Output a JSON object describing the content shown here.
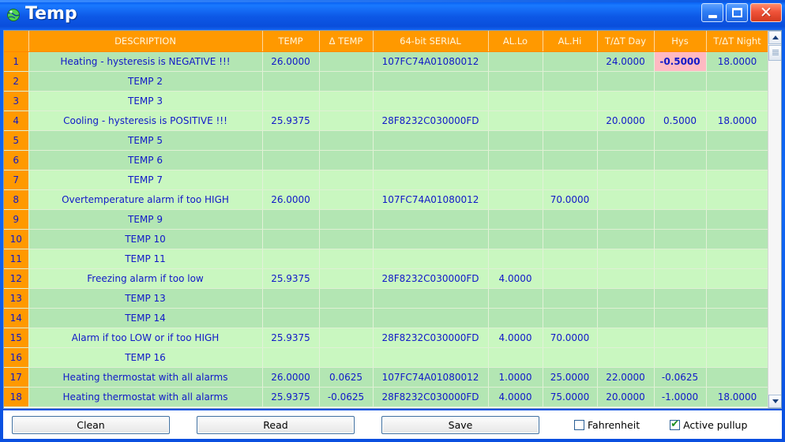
{
  "window": {
    "title": "Temp",
    "icon": "globe-icon",
    "minimize_label": "–",
    "maximize_label": "☐",
    "close_label": "✕",
    "accent_titlebar": "#0d58e6",
    "accent_header": "#ff9900",
    "row_dark": "#b3e6b3",
    "row_light": "#c9f7c0",
    "highlight_bg": "#ffb9c2",
    "text_color": "#1018c8"
  },
  "grid": {
    "columns": [
      {
        "key": "num",
        "label": ""
      },
      {
        "key": "desc",
        "label": "DESCRIPTION"
      },
      {
        "key": "temp",
        "label": "TEMP"
      },
      {
        "key": "dtemp",
        "label": "Δ TEMP"
      },
      {
        "key": "ser",
        "label": "64-bit SERIAL"
      },
      {
        "key": "allo",
        "label": "AL.Lo"
      },
      {
        "key": "alhi",
        "label": "AL.Hi"
      },
      {
        "key": "day",
        "label": "T/ΔT Day"
      },
      {
        "key": "hys",
        "label": "Hys"
      },
      {
        "key": "night",
        "label": "T/ΔT Night"
      }
    ],
    "rows": [
      {
        "num": "1",
        "desc": "Heating - hysteresis is NEGATIVE !!!",
        "temp": "26.0000",
        "dtemp": "",
        "ser": "107FC74A01080012",
        "allo": "",
        "alhi": "",
        "day": "24.0000",
        "hys": "-0.5000",
        "night": "18.0000",
        "shade": "dark",
        "hys_highlight": true
      },
      {
        "num": "2",
        "desc": "TEMP 2",
        "temp": "",
        "dtemp": "",
        "ser": "",
        "allo": "",
        "alhi": "",
        "day": "",
        "hys": "",
        "night": "",
        "shade": "dark",
        "hys_highlight": false
      },
      {
        "num": "3",
        "desc": "TEMP 3",
        "temp": "",
        "dtemp": "",
        "ser": "",
        "allo": "",
        "alhi": "",
        "day": "",
        "hys": "",
        "night": "",
        "shade": "light",
        "hys_highlight": false
      },
      {
        "num": "4",
        "desc": "Cooling - hysteresis is POSITIVE !!!",
        "temp": "25.9375",
        "dtemp": "",
        "ser": "28F8232C030000FD",
        "allo": "",
        "alhi": "",
        "day": "20.0000",
        "hys": "0.5000",
        "night": "18.0000",
        "shade": "light",
        "hys_highlight": false
      },
      {
        "num": "5",
        "desc": "TEMP 5",
        "temp": "",
        "dtemp": "",
        "ser": "",
        "allo": "",
        "alhi": "",
        "day": "",
        "hys": "",
        "night": "",
        "shade": "dark",
        "hys_highlight": false
      },
      {
        "num": "6",
        "desc": "TEMP 6",
        "temp": "",
        "dtemp": "",
        "ser": "",
        "allo": "",
        "alhi": "",
        "day": "",
        "hys": "",
        "night": "",
        "shade": "dark",
        "hys_highlight": false
      },
      {
        "num": "7",
        "desc": "TEMP 7",
        "temp": "",
        "dtemp": "",
        "ser": "",
        "allo": "",
        "alhi": "",
        "day": "",
        "hys": "",
        "night": "",
        "shade": "light",
        "hys_highlight": false
      },
      {
        "num": "8",
        "desc": "Overtemperature alarm if too HIGH",
        "temp": "26.0000",
        "dtemp": "",
        "ser": "107FC74A01080012",
        "allo": "",
        "alhi": "70.0000",
        "day": "",
        "hys": "",
        "night": "",
        "shade": "light",
        "hys_highlight": false
      },
      {
        "num": "9",
        "desc": "TEMP 9",
        "temp": "",
        "dtemp": "",
        "ser": "",
        "allo": "",
        "alhi": "",
        "day": "",
        "hys": "",
        "night": "",
        "shade": "dark",
        "hys_highlight": false
      },
      {
        "num": "10",
        "desc": "TEMP 10",
        "temp": "",
        "dtemp": "",
        "ser": "",
        "allo": "",
        "alhi": "",
        "day": "",
        "hys": "",
        "night": "",
        "shade": "dark",
        "hys_highlight": false
      },
      {
        "num": "11",
        "desc": "TEMP 11",
        "temp": "",
        "dtemp": "",
        "ser": "",
        "allo": "",
        "alhi": "",
        "day": "",
        "hys": "",
        "night": "",
        "shade": "light",
        "hys_highlight": false
      },
      {
        "num": "12",
        "desc": "Freezing alarm if too low",
        "temp": "25.9375",
        "dtemp": "",
        "ser": "28F8232C030000FD",
        "allo": "4.0000",
        "alhi": "",
        "day": "",
        "hys": "",
        "night": "",
        "shade": "light",
        "hys_highlight": false
      },
      {
        "num": "13",
        "desc": "TEMP 13",
        "temp": "",
        "dtemp": "",
        "ser": "",
        "allo": "",
        "alhi": "",
        "day": "",
        "hys": "",
        "night": "",
        "shade": "dark",
        "hys_highlight": false
      },
      {
        "num": "14",
        "desc": "TEMP 14",
        "temp": "",
        "dtemp": "",
        "ser": "",
        "allo": "",
        "alhi": "",
        "day": "",
        "hys": "",
        "night": "",
        "shade": "dark",
        "hys_highlight": false
      },
      {
        "num": "15",
        "desc": "Alarm if too LOW or if too HIGH",
        "temp": "25.9375",
        "dtemp": "",
        "ser": "28F8232C030000FD",
        "allo": "4.0000",
        "alhi": "70.0000",
        "day": "",
        "hys": "",
        "night": "",
        "shade": "light",
        "hys_highlight": false
      },
      {
        "num": "16",
        "desc": "TEMP 16",
        "temp": "",
        "dtemp": "",
        "ser": "",
        "allo": "",
        "alhi": "",
        "day": "",
        "hys": "",
        "night": "",
        "shade": "light",
        "hys_highlight": false
      },
      {
        "num": "17",
        "desc": "Heating thermostat with all alarms",
        "temp": "26.0000",
        "dtemp": "0.0625",
        "ser": "107FC74A01080012",
        "allo": "1.0000",
        "alhi": "25.0000",
        "day": "22.0000",
        "hys": "-0.0625",
        "night": "",
        "shade": "dark",
        "hys_highlight": false
      },
      {
        "num": "18",
        "desc": "Heating thermostat with all alarms",
        "temp": "25.9375",
        "dtemp": "-0.0625",
        "ser": "28F8232C030000FD",
        "allo": "4.0000",
        "alhi": "75.0000",
        "day": "20.0000",
        "hys": "-1.0000",
        "night": "18.0000",
        "shade": "dark",
        "hys_highlight": false
      }
    ]
  },
  "scrollbar": {
    "up_icon": "chevron-up-icon",
    "down_icon": "chevron-down-icon",
    "thumb_icon": "scroll-thumb-grip"
  },
  "footer": {
    "clean_label": "Clean",
    "read_label": "Read",
    "save_label": "Save",
    "fahrenheit_label": "Fahrenheit",
    "fahrenheit_checked": false,
    "pullup_label": "Active pullup",
    "pullup_checked": true,
    "check_glyph": "✔"
  }
}
